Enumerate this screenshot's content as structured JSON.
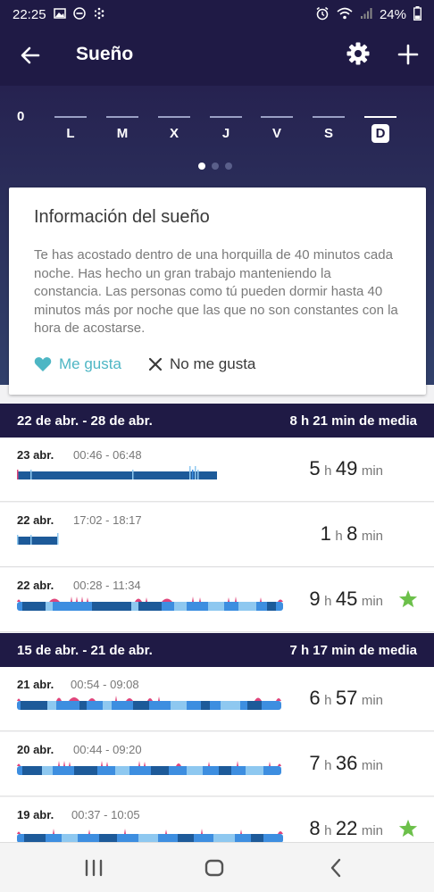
{
  "status_bar": {
    "time": "22:25",
    "battery": "24%",
    "left_icons": [
      "image-icon",
      "dnd-icon",
      "fitbit-icon"
    ],
    "right_icons": [
      "alarm-icon",
      "wifi-icon",
      "signal-icon",
      "battery-icon"
    ]
  },
  "app_bar": {
    "title": "Sueño",
    "back_icon": "arrow-left-icon",
    "settings_icon": "gear-icon",
    "add_icon": "plus-icon"
  },
  "week_chart": {
    "zero_label": "0",
    "days": [
      "L",
      "M",
      "X",
      "J",
      "V",
      "S",
      "D"
    ],
    "selected_day": "D",
    "pages": 3,
    "active_page": 1
  },
  "info_card": {
    "title": "Información del sueño",
    "text": "Te has acostado dentro de una horquilla de 40 minutos cada noche. Has hecho un gran trabajo manteniendo la constancia. Las personas como tú pueden dormir hasta 40 minutos más por noche que las que no son constantes con la hora de acostarse.",
    "like_label": "Me gusta",
    "dislike_label": "No me gusta"
  },
  "weeks": [
    {
      "range": "22 de abr. - 28 de abr.",
      "average": "8 h 21 min de media",
      "entries": [
        {
          "date": "23 abr.",
          "time": "00:46 - 06:48",
          "hours": "5",
          "minutes": "49",
          "h_unit": "h",
          "min_unit": "min",
          "star": false
        },
        {
          "date": "22 abr.",
          "time": "17:02 - 18:17",
          "hours": "1",
          "minutes": "8",
          "h_unit": "h",
          "min_unit": "min",
          "star": false
        },
        {
          "date": "22 abr.",
          "time": "00:28 - 11:34",
          "hours": "9",
          "minutes": "45",
          "h_unit": "h",
          "min_unit": "min",
          "star": true
        }
      ]
    },
    {
      "range": "15 de abr. - 21 de abr.",
      "average": "7 h 17 min de media",
      "entries": [
        {
          "date": "21 abr.",
          "time": "00:54 - 09:08",
          "hours": "6",
          "minutes": "57",
          "h_unit": "h",
          "min_unit": "min",
          "star": false
        },
        {
          "date": "20 abr.",
          "time": "00:44 - 09:20",
          "hours": "7",
          "minutes": "36",
          "h_unit": "h",
          "min_unit": "min",
          "star": false
        },
        {
          "date": "19 abr.",
          "time": "00:37 - 10:05",
          "hours": "8",
          "minutes": "22",
          "h_unit": "h",
          "min_unit": "min",
          "star": true
        }
      ]
    }
  ],
  "colors": {
    "header_bg": "#1f1a45",
    "accent_like": "#4db6c4",
    "star": "#6cc04a",
    "sleep_dark": "#1d5a99",
    "sleep_mid": "#3d8ee0",
    "sleep_light": "#8ec8f0",
    "sleep_awake": "#e0457b"
  },
  "nav_bar": {
    "icons": [
      "recent-apps-icon",
      "home-icon",
      "back-nav-icon"
    ]
  }
}
